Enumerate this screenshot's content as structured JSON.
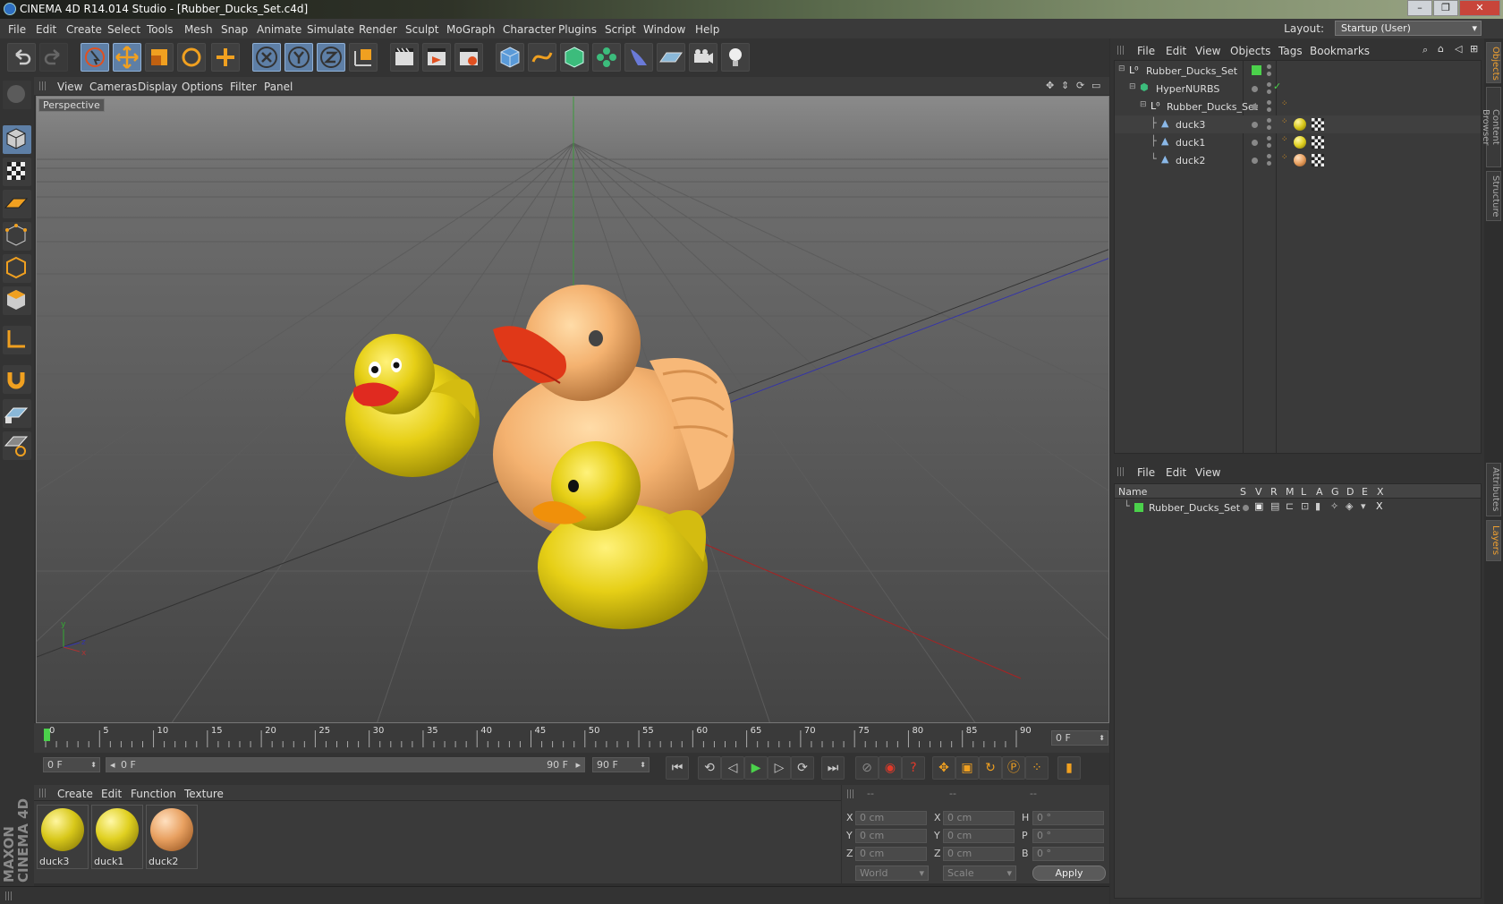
{
  "window": {
    "title": "CINEMA 4D R14.014 Studio - [Rubber_Ducks_Set.c4d]"
  },
  "menubar": {
    "items": [
      "File",
      "Edit",
      "Create",
      "Select",
      "Tools",
      "Mesh",
      "Snap",
      "Animate",
      "Simulate",
      "Render",
      "Sculpt",
      "MoGraph",
      "Character",
      "Plugins",
      "Script",
      "Window",
      "Help"
    ],
    "layout_label": "Layout:",
    "layout_value": "Startup (User)"
  },
  "toolbar": {
    "icons": [
      "undo-icon",
      "redo-icon",
      "live-select-icon",
      "move-icon",
      "scale-icon",
      "rotate-icon",
      "add-object-icon",
      "x-axis-icon",
      "y-axis-icon",
      "z-axis-icon",
      "world-coords-icon",
      "render-view-icon",
      "render-picture-viewer-icon",
      "edit-render-settings-icon",
      "cube-primitive-icon",
      "spline-icon",
      "nurbs-icon",
      "array-icon",
      "deformer-icon",
      "floor-icon",
      "camera-icon",
      "light-icon"
    ]
  },
  "viewport": {
    "menu": [
      "View",
      "Cameras",
      "Display",
      "Options",
      "Filter",
      "Panel"
    ],
    "label": "Perspective"
  },
  "timeline": {
    "ticks": [
      "0",
      "5",
      "10",
      "15",
      "20",
      "25",
      "30",
      "35",
      "40",
      "45",
      "50",
      "55",
      "60",
      "65",
      "70",
      "75",
      "80",
      "85",
      "90"
    ],
    "current_frame": "0 F",
    "start_frame": "0 F",
    "range_start": "0 F",
    "range_end": "90 F",
    "end_frame": "90 F"
  },
  "materials": {
    "menu": [
      "Create",
      "Edit",
      "Function",
      "Texture"
    ],
    "items": [
      {
        "name": "duck3",
        "color": "#d8c81a"
      },
      {
        "name": "duck1",
        "color": "#e0d020"
      },
      {
        "name": "duck2",
        "color": "#e8a060"
      }
    ]
  },
  "coordinates": {
    "headers": [
      "--",
      "--",
      "--"
    ],
    "pos": [
      {
        "label": "X",
        "value": "0 cm"
      },
      {
        "label": "Y",
        "value": "0 cm"
      },
      {
        "label": "Z",
        "value": "0 cm"
      }
    ],
    "size": [
      {
        "label": "X",
        "value": "0 cm"
      },
      {
        "label": "Y",
        "value": "0 cm"
      },
      {
        "label": "Z",
        "value": "0 cm"
      }
    ],
    "rot": [
      {
        "label": "H",
        "value": "0 °"
      },
      {
        "label": "P",
        "value": "0 °"
      },
      {
        "label": "B",
        "value": "0 °"
      }
    ],
    "mode": "World",
    "transform": "Scale",
    "apply": "Apply"
  },
  "objects": {
    "menu": [
      "File",
      "Edit",
      "View",
      "Objects",
      "Tags",
      "Bookmarks"
    ],
    "rows": [
      {
        "name": "Rubber_Ducks_Set"
      },
      {
        "name": "HyperNURBS"
      },
      {
        "name": "Rubber_Ducks_Set"
      },
      {
        "name": "duck3"
      },
      {
        "name": "duck1"
      },
      {
        "name": "duck2"
      }
    ]
  },
  "layers": {
    "menu": [
      "File",
      "Edit",
      "View"
    ],
    "columns": [
      "Name",
      "S",
      "V",
      "R",
      "M",
      "L",
      "A",
      "G",
      "D",
      "E",
      "X"
    ],
    "rows": [
      {
        "name": "Rubber_Ducks_Set",
        "color": "#4cd14c"
      }
    ]
  },
  "sidetabs": [
    "Objects",
    "Content Browser",
    "Structure",
    "Attributes",
    "Layers"
  ]
}
